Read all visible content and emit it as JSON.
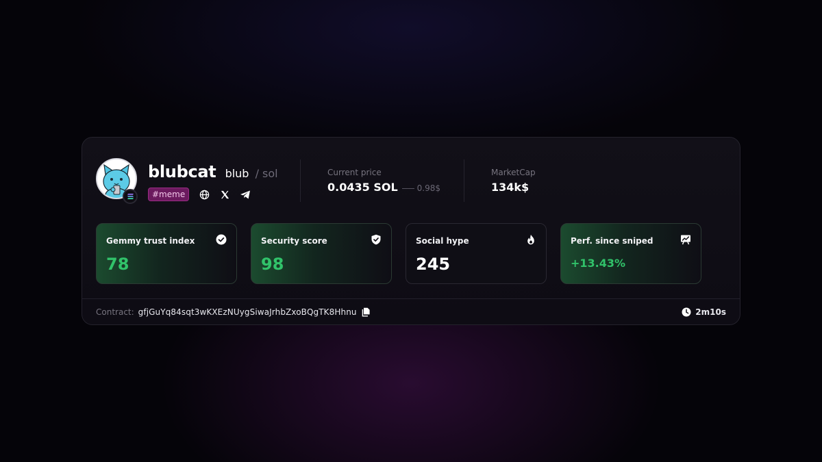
{
  "token": {
    "name": "blubcat",
    "ticker": "blub",
    "chain": "/ sol",
    "tag": "#meme",
    "social_icons": [
      "globe-icon",
      "x-icon",
      "telegram-icon"
    ]
  },
  "price": {
    "label": "Current price",
    "value": "0.0435 SOL",
    "usd": "0.98$"
  },
  "marketcap": {
    "label": "MarketCap",
    "value": "134k$"
  },
  "tiles": [
    {
      "label": "Gemmy trust index",
      "value": "78",
      "icon": "check-circle-icon"
    },
    {
      "label": "Security score",
      "value": "98",
      "icon": "shield-check-icon"
    },
    {
      "label": "Social hype",
      "value": "245",
      "icon": "fire-icon"
    },
    {
      "label": "Perf. since sniped",
      "value": "+13.43%",
      "icon": "chart-board-icon"
    }
  ],
  "footer": {
    "contract_label": "Contract:",
    "contract_address": "gfjGuYq84sqt3wKXEzNUygSiwaJrhbZxoBQgTK8Hhnu",
    "timer": "2m10s"
  },
  "colors": {
    "accent_green": "#31c26a",
    "tag_bg": "#6b1a5e",
    "background": "#050409"
  }
}
